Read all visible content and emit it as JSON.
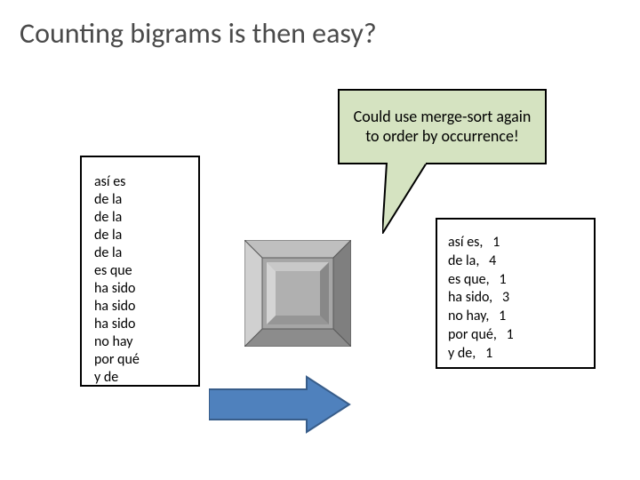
{
  "title": "Counting bigrams is then easy?",
  "callout_text": "Could use merge-sort again to order by occurrence!",
  "input_bigrams": [
    "así es",
    "de la",
    "de la",
    "de la",
    "de la",
    "es que",
    "ha sido",
    "ha sido",
    "ha sido",
    "no hay",
    "por qué",
    "y de"
  ],
  "output_counts": [
    {
      "bigram": "así es",
      "count": 1
    },
    {
      "bigram": "de la",
      "count": 4
    },
    {
      "bigram": "es que",
      "count": 1
    },
    {
      "bigram": "ha sido",
      "count": 3
    },
    {
      "bigram": "no hay",
      "count": 1
    },
    {
      "bigram": "por qué",
      "count": 1
    },
    {
      "bigram": "y de",
      "count": 1
    }
  ],
  "colors": {
    "callout_bg": "#d5e3c1",
    "machine_light": "#d9d9d9",
    "machine_mid": "#a6a6a6",
    "machine_dark": "#6f6f6f",
    "arrow_fill": "#4f81bd",
    "arrow_stroke": "#385d8a"
  }
}
